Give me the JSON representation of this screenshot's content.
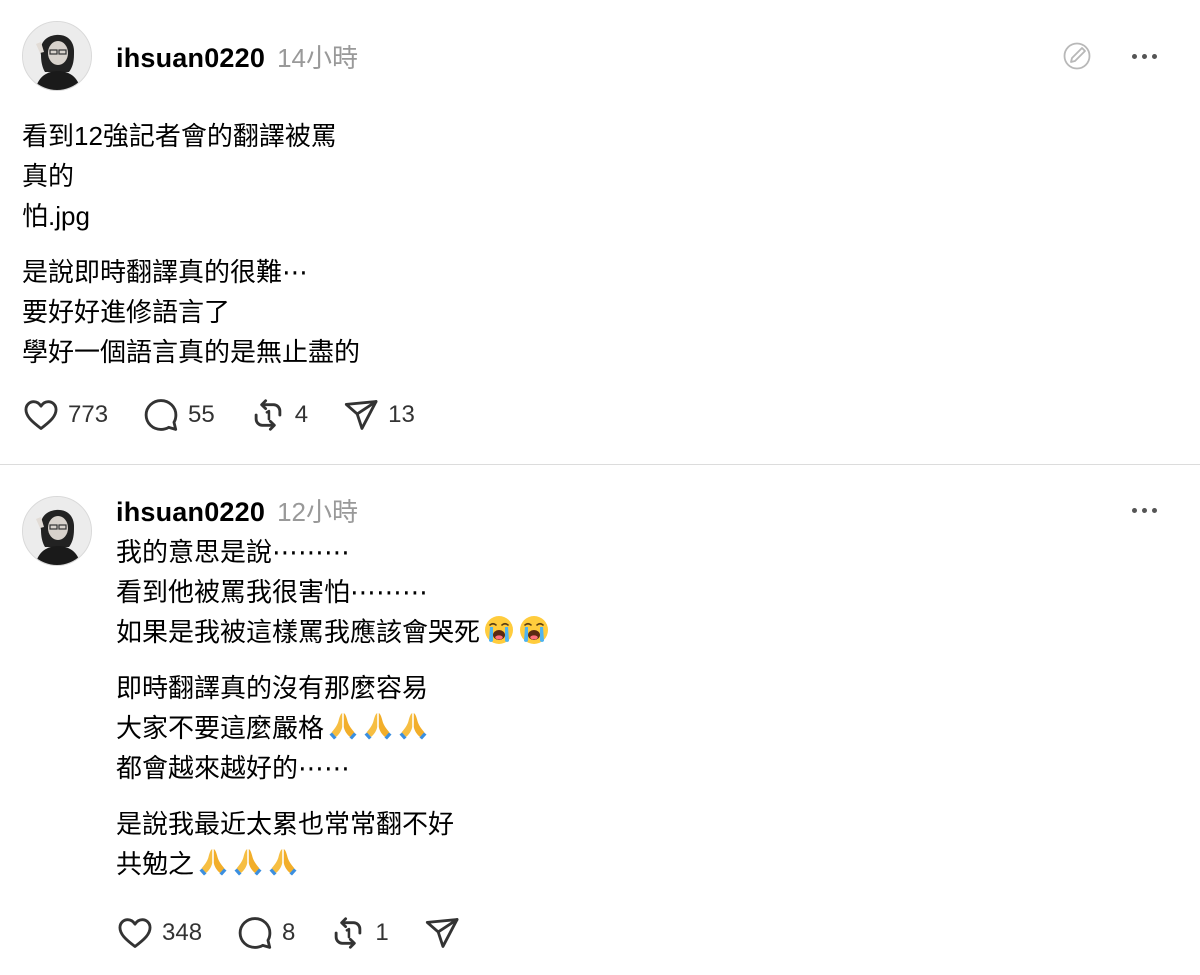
{
  "posts": [
    {
      "username": "ihsuan0220",
      "time": "14小時",
      "paragraphs": [
        [
          "看到12強記者會的翻譯被罵",
          "真的",
          "怕.jpg"
        ],
        [
          "是說即時翻譯真的很難⋯",
          "要好好進修語言了",
          "學好一個語言真的是無止盡的"
        ]
      ],
      "likes": "773",
      "comments": "55",
      "reposts": "4",
      "shares": "13"
    },
    {
      "username": "ihsuan0220",
      "time": "12小時",
      "paragraphs": [
        [
          "我的意思是說⋯⋯⋯",
          "看到他被罵我很害怕⋯⋯⋯",
          "如果是我被這樣罵我應該會哭死"
        ],
        [
          "即時翻譯真的沒有那麼容易",
          "大家不要這麼嚴格",
          "都會越來越好的⋯⋯"
        ],
        [
          "是說我最近太累也常常翻不好",
          "共勉之"
        ]
      ],
      "likes": "348",
      "comments": "8",
      "reposts": "1"
    }
  ],
  "icons": {
    "like": "heart-icon",
    "comment": "speech-bubble-icon",
    "repost": "repost-arrows-icon",
    "share": "paper-plane-icon",
    "more": "ellipsis-icon",
    "edit": "edit-icon",
    "crying_emoji": "loudly-crying-face",
    "pray_emoji": "folded-hands"
  },
  "colors": {
    "text": "#000000",
    "muted": "#999999",
    "divider": "#dcdcdc",
    "icon": "#333333"
  }
}
